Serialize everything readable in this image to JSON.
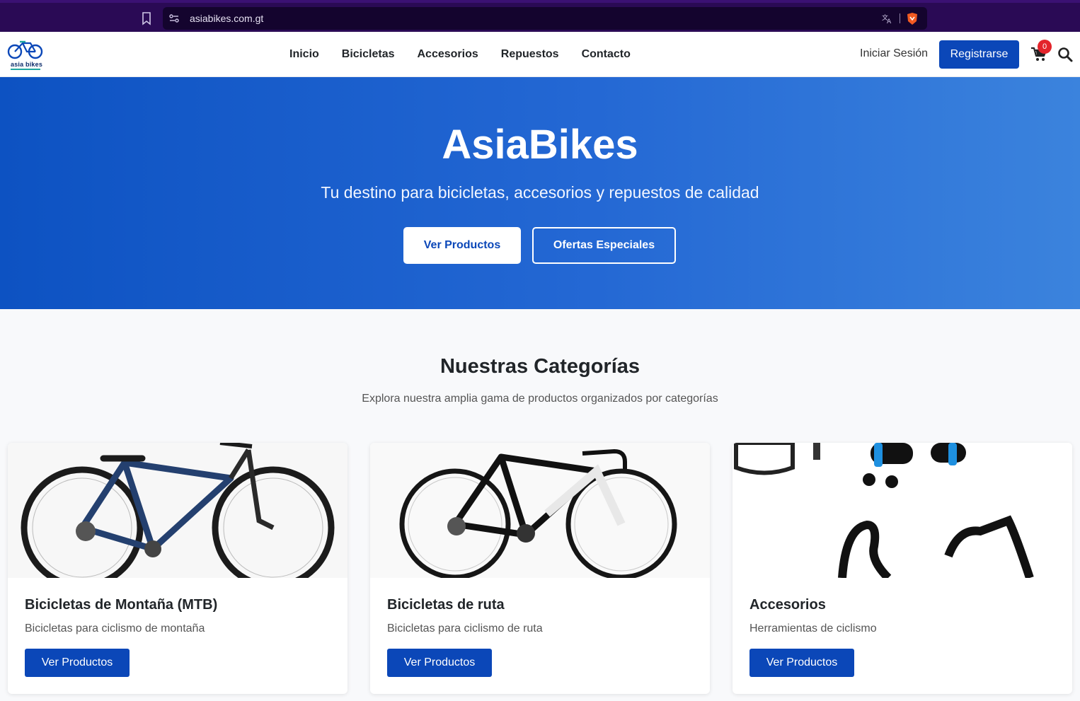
{
  "browser": {
    "url": "asiabikes.com.gt"
  },
  "navbar": {
    "logo_text": "asia bikes",
    "links": [
      "Inicio",
      "Bicicletas",
      "Accesorios",
      "Repuestos",
      "Contacto"
    ],
    "login_label": "Iniciar Sesión",
    "register_label": "Registrarse",
    "cart_count": "0"
  },
  "hero": {
    "title": "AsiaBikes",
    "subtitle": "Tu destino para bicicletas, accesorios y repuestos de calidad",
    "primary_button": "Ver Productos",
    "secondary_button": "Ofertas Especiales"
  },
  "categories": {
    "title": "Nuestras Categorías",
    "subtitle": "Explora nuestra amplia gama de productos organizados por categorías",
    "cards": [
      {
        "title": "Bicicletas de Montaña (MTB)",
        "description": "Bicicletas para ciclismo de montaña",
        "button": "Ver Productos"
      },
      {
        "title": "Bicicletas de ruta",
        "description": "Bicicletas para ciclismo de ruta",
        "button": "Ver Productos"
      },
      {
        "title": "Accesorios",
        "description": "Herramientas de ciclismo",
        "button": "Ver Productos"
      }
    ]
  },
  "colors": {
    "brand_blue": "#0b47b8",
    "hero_start": "#0d52c2",
    "hero_end": "#3b83dd",
    "badge_red": "#e3242b"
  }
}
